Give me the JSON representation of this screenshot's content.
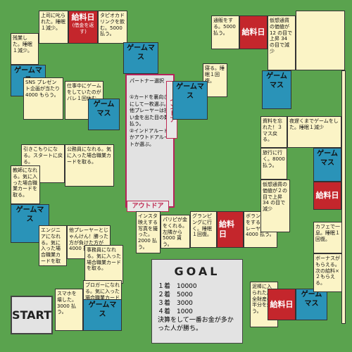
{
  "squares": {
    "s1": "上司に叱られた。睡眠１減少。",
    "s2": "給料日",
    "s2b": "(借金を返す)",
    "s3": "タピオカドリンクを飲む。5000 払う。",
    "s4": "ゲームマス",
    "s5": "残業した。睡眠１減少。",
    "s6": "ゲームマス",
    "s7": "SNS プレゼント企画が当たり 4000 もらう。",
    "s8": "仕事中にゲームをしていたのがバレ１回休む。",
    "s9": "ゲームマス",
    "s10": "引きこもりになる。スタートに戻る。",
    "s11": "公務員になれる。気に入った場合職業カードを取る。",
    "s12": "教師になれる。気に入った場合職業カードを取る。",
    "s13": "ゲームマス",
    "s14": "エンジニアになれる。気に入った場合職業カードを取る。",
    "s15": "他プレーヤーとじゃんけん！勝った方が負けた方が 4000 払う。",
    "s16": "事務員になれる。気に入った場合職業カードを取る。",
    "s17": "ブロガーになれる。気に入った場合職業カードを取る。",
    "s18": "スマホを壊した。3000 払う。",
    "s19": "ゲームマス",
    "s20": "インスタ映えする写真を撮った。2000 払う。",
    "s21": "パリピが金をくれる。左隣から 5000 貰う。",
    "s22": "グランピングに行く。睡眠１回復。",
    "s23": "給料日",
    "s24": "ボランティアをする。他プレーヤーに 4000 払う。",
    "s25": "泥棒に入られた。全財産の半分を失う。",
    "s26": "給料日",
    "s27": "ゲームマス",
    "s28": "カフェで一息。睡眠１回復。",
    "s29": "ボーナスがもらえる。次の給料×２もらえる。",
    "s30": "給料日",
    "s31": "ゲームマス",
    "s32": "仮想通貨の価値が２の目で上昇 34 の目で減少",
    "s33": "旅行に行く。8000 払う。",
    "s34": "資料を忘れた！３マス戻る。",
    "s35": "夜遅くまでゲームをした。睡眠１減少",
    "s36": "ゲームマス",
    "s37": "寝る。睡眠１回復。",
    "s38": "ゲームマス",
    "s39": "通販をする。5000 払う。",
    "s40": "給料日",
    "s41": "仮想通貨の価値が 12 の目で上昇 34 の目で減少"
  },
  "partner": {
    "title": "パートナー選択",
    "line1": "①カードを裏向きにして一枚選ぶ。",
    "line2": "他プレーヤーは掛い金を出た目の数払う。",
    "line3": "②インドアルートかアウトドアルートか選ぶ。",
    "indoor": "インドア",
    "outdoor": "アウトドア"
  },
  "goal": {
    "title": "GOAL",
    "r1": "１着　10000",
    "r2": "２着　5000",
    "r3": "３着　3000",
    "r4": "４着　1000",
    "note": "決算をして一番お金が多かった人が勝ち。"
  },
  "start": "START",
  "colors": {
    "board": "#5aa34e",
    "cell": "#fbf4c6",
    "red": "#c4262c",
    "teal": "#2a93b8"
  }
}
